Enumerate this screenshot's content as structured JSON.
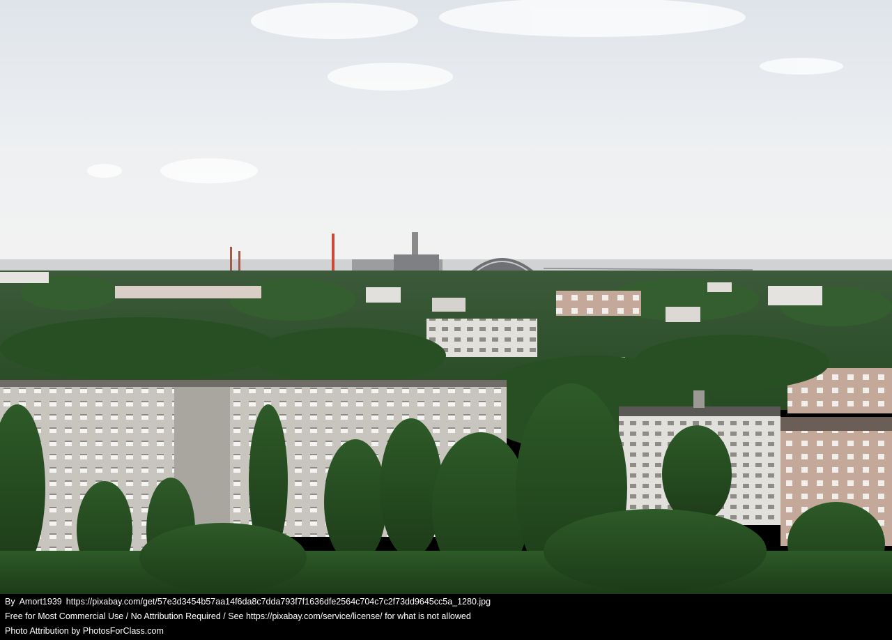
{
  "photo": {
    "subject": "Aerial view over abandoned apartment blocks and dense forest toward industrial plant on horizon under overcast sky"
  },
  "caption": {
    "by_label": "By",
    "author": "Amort1939",
    "source_url": "https://pixabay.com/get/57e3d3454b57aa14f6da8c7dda793f7f1636dfe2564c704c7c2f73dd9645cc5a_1280.jpg",
    "license_text": "Free for Most Commercial Use / No Attribution Required / See https://pixabay.com/service/license/ for what is not allowed",
    "attribution_text": "Photo Attribution by PhotosForClass.com"
  },
  "colors": {
    "sky": "#e9ecef",
    "forest": "#2f5a2a",
    "building": "#c9c6c0",
    "caption_bg": "#000000",
    "caption_text": "#ffffff"
  }
}
